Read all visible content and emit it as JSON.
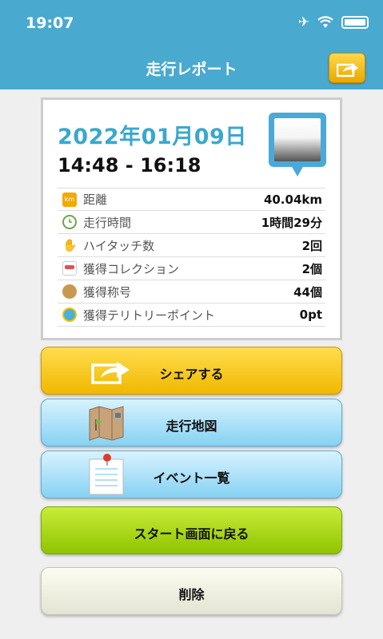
{
  "status_bar": {
    "time": "19:07"
  },
  "nav": {
    "title": "走行レポート"
  },
  "report": {
    "date": "2022年01月09日",
    "time_range": "14:48 - 16:18",
    "stats": [
      {
        "icon": "km-icon",
        "label": "距離",
        "value": "40.04km",
        "color": "#f2a900",
        "glyph": "km"
      },
      {
        "icon": "clock-icon",
        "label": "走行時間",
        "value": "1時間29分",
        "color": "#6aa64a",
        "glyph": ""
      },
      {
        "icon": "hand-icon",
        "label": "ハイタッチ数",
        "value": "2回",
        "color": "#3aa8cc",
        "glyph": ""
      },
      {
        "icon": "collection-icon",
        "label": "獲得コレクション",
        "value": "2個",
        "color": "#e0505a",
        "glyph": ""
      },
      {
        "icon": "title-icon",
        "label": "獲得称号",
        "value": "44個",
        "color": "#c99850",
        "glyph": ""
      },
      {
        "icon": "territory-icon",
        "label": "獲得テリトリーポイント",
        "value": "0pt",
        "color": "#4ab0dc",
        "glyph": ""
      }
    ]
  },
  "buttons": {
    "share": "シェアする",
    "map": "走行地図",
    "events": "イベント一覧",
    "back_to_start": "スタート画面に戻る",
    "delete": "削除"
  }
}
